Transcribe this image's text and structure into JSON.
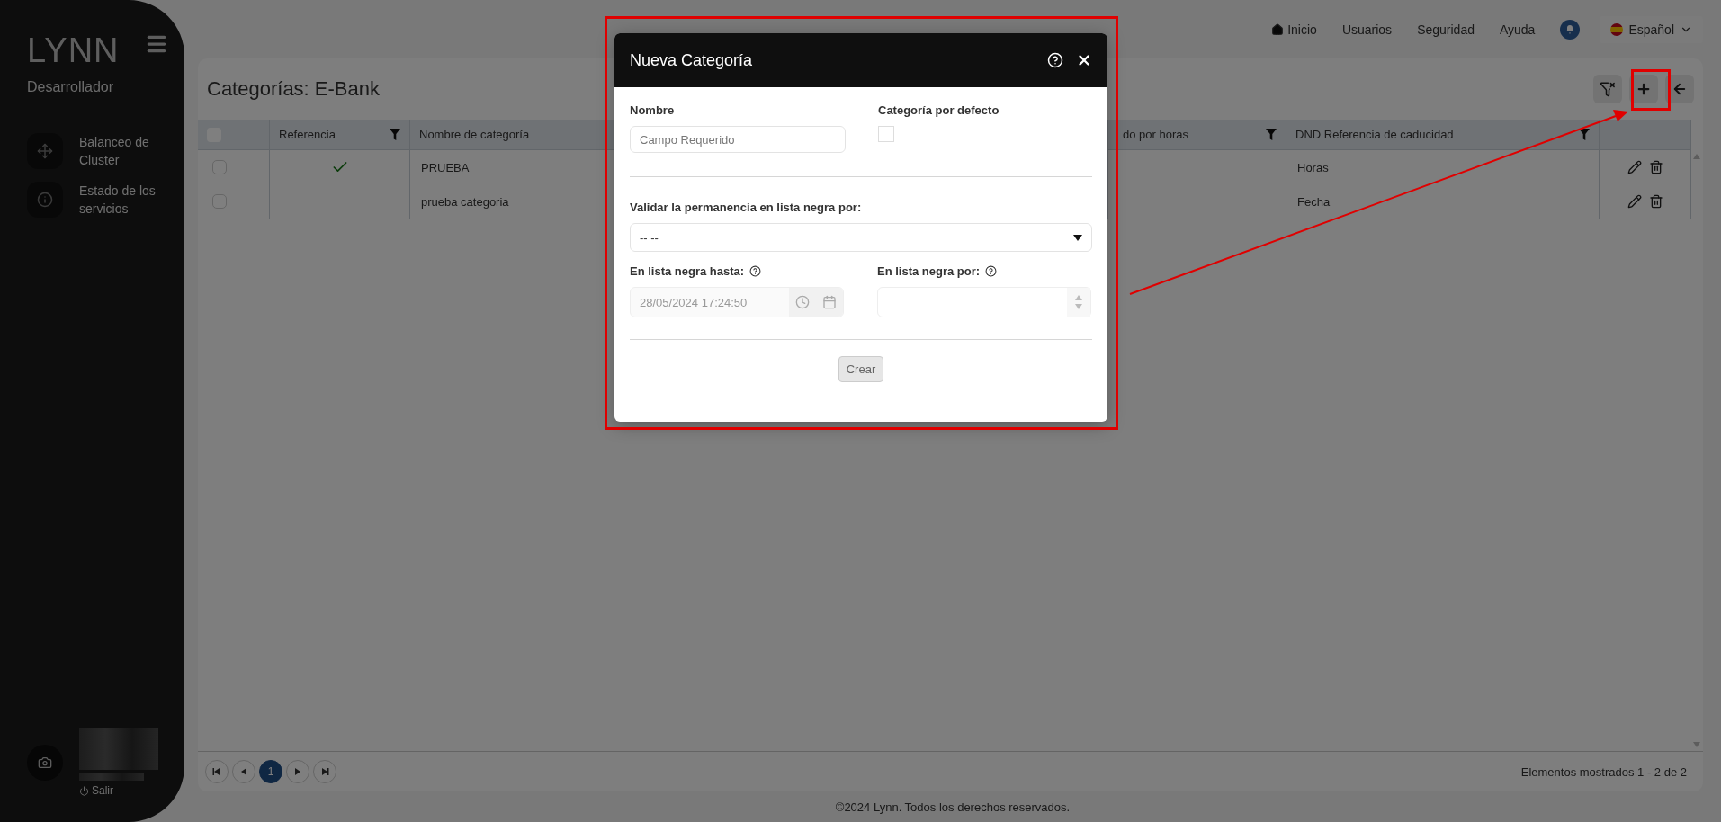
{
  "sidebar": {
    "logo": "LYNN",
    "role": "Desarrollador",
    "items": [
      {
        "kind": "cluster",
        "label": "Balanceo de Cluster"
      },
      {
        "kind": "info",
        "label": "Estado de los servicios"
      }
    ],
    "logout": "Salir"
  },
  "top_nav": {
    "links": [
      {
        "label": "Inicio",
        "kind": "home"
      },
      {
        "label": "Usuarios",
        "kind": "text"
      },
      {
        "label": "Seguridad",
        "kind": "text"
      },
      {
        "label": "Ayuda",
        "kind": "text"
      }
    ],
    "language": "Español"
  },
  "page": {
    "title": "Categorías: E-Bank"
  },
  "table": {
    "all_selected": false,
    "columns": [
      {
        "label": "Referencia",
        "filter": true
      },
      {
        "label": "Nombre de categoría"
      },
      {
        "label": "do por horas",
        "filter": true
      },
      {
        "label": "DND Referencia de caducidad",
        "filter": true
      }
    ],
    "rows": [
      {
        "selected": false,
        "reference": true,
        "name": "PRUEBA",
        "expiry": "Horas"
      },
      {
        "selected": false,
        "reference": false,
        "name": "prueba categoria",
        "expiry": "Fecha"
      }
    ]
  },
  "pagination": {
    "pages": [
      {
        "label": "1",
        "selected": true
      }
    ],
    "summary": "Elementos mostrados 1 - 2 de 2"
  },
  "footer": "©2024 Lynn. Todos los derechos reservados.",
  "modal": {
    "title": "Nueva Categoría",
    "name_label": "Nombre",
    "name_placeholder": "Campo Requerido",
    "default_label": "Categoría por defecto",
    "default_checked": false,
    "validate_label": "Validar la permanencia en lista negra por:",
    "validate_value": "-- --",
    "until_label": "En lista negra hasta:",
    "until_value": "28/05/2024 17:24:50",
    "until_disabled": true,
    "for_label": "En lista negra por:",
    "submit": "Crear",
    "submit_disabled": true
  }
}
